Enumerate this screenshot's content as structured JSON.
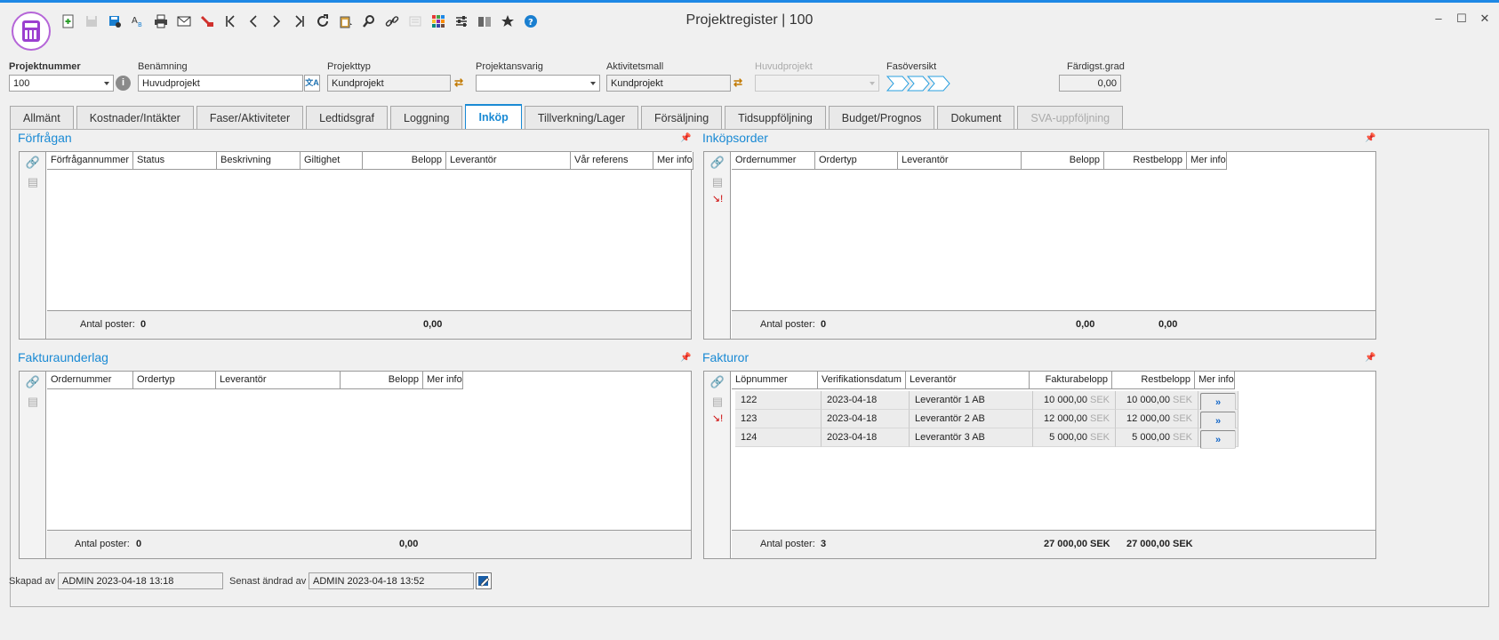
{
  "window": {
    "title": "Projektregister | 100",
    "minimize": "–",
    "maximize": "☐",
    "close": "✕"
  },
  "toolbar": [
    "new-icon",
    "save-icon",
    "save-as-icon",
    "spellcheck-icon",
    "print-icon",
    "mail-icon",
    "pdf-icon",
    "first-icon",
    "prev-icon",
    "next-icon",
    "last-icon",
    "refresh-icon",
    "clipboard-icon",
    "search-icon",
    "link-icon",
    "report-icon",
    "grid-icon",
    "settings-icon",
    "compare-icon",
    "favorite-icon",
    "help-icon"
  ],
  "header": {
    "projektnummer_label": "Projektnummer",
    "projektnummer_value": "100",
    "benamning_label": "Benämning",
    "benamning_value": "Huvudprojekt",
    "projekttyp_label": "Projekttyp",
    "projekttyp_value": "Kundprojekt",
    "projektansvarig_label": "Projektansvarig",
    "projektansvarig_value": "",
    "aktivitetsmall_label": "Aktivitetsmall",
    "aktivitetsmall_value": "Kundprojekt",
    "huvudprojekt_label": "Huvudprojekt",
    "huvudprojekt_value": "",
    "fasoversikt_label": "Fasöversikt",
    "fardigst_label": "Färdigst.grad",
    "fardigst_value": "0,00"
  },
  "tabs": [
    {
      "label": "Allmänt",
      "state": "normal"
    },
    {
      "label": "Kostnader/Intäkter",
      "state": "normal"
    },
    {
      "label": "Faser/Aktiviteter",
      "state": "normal"
    },
    {
      "label": "Ledtidsgraf",
      "state": "normal"
    },
    {
      "label": "Loggning",
      "state": "normal"
    },
    {
      "label": "Inköp",
      "state": "active"
    },
    {
      "label": "Tillverkning/Lager",
      "state": "normal"
    },
    {
      "label": "Försäljning",
      "state": "normal"
    },
    {
      "label": "Tidsuppföljning",
      "state": "normal"
    },
    {
      "label": "Budget/Prognos",
      "state": "normal"
    },
    {
      "label": "Dokument",
      "state": "normal"
    },
    {
      "label": "SVA-uppföljning",
      "state": "disabled"
    }
  ],
  "forfragan": {
    "title": "Förfrågan",
    "columns": [
      "Förfrågannummer",
      "Status",
      "Beskrivning",
      "Giltighet",
      "Belopp",
      "Leverantör",
      "Vår referens",
      "Mer info"
    ],
    "footer_label": "Antal poster:",
    "count": "0",
    "sum": "0,00"
  },
  "inkopsorder": {
    "title": "Inköpsorder",
    "columns": [
      "Ordernummer",
      "Ordertyp",
      "Leverantör",
      "Belopp",
      "Restbelopp",
      "Mer info"
    ],
    "footer_label": "Antal poster:",
    "count": "0",
    "sum1": "0,00",
    "sum2": "0,00"
  },
  "fakturaunderlag": {
    "title": "Fakturaunderlag",
    "columns": [
      "Ordernummer",
      "Ordertyp",
      "Leverantör",
      "Belopp",
      "Mer info"
    ],
    "footer_label": "Antal poster:",
    "count": "0",
    "sum": "0,00"
  },
  "fakturor": {
    "title": "Fakturor",
    "columns": [
      "Löpnummer",
      "Verifikationsdatum",
      "Leverantör",
      "Fakturabelopp",
      "Restbelopp",
      "Mer info"
    ],
    "rows": [
      {
        "lopnummer": "122",
        "datum": "2023-04-18",
        "leverantor": "Leverantör 1 AB",
        "belopp": "10 000,00",
        "valuta": "SEK",
        "rest": "10 000,00",
        "rest_valuta": "SEK"
      },
      {
        "lopnummer": "123",
        "datum": "2023-04-18",
        "leverantor": "Leverantör 2 AB",
        "belopp": "12 000,00",
        "valuta": "SEK",
        "rest": "12 000,00",
        "rest_valuta": "SEK"
      },
      {
        "lopnummer": "124",
        "datum": "2023-04-18",
        "leverantor": "Leverantör 3 AB",
        "belopp": "5 000,00",
        "valuta": "SEK",
        "rest": "5 000,00",
        "rest_valuta": "SEK"
      }
    ],
    "more_button": "»",
    "footer_label": "Antal poster:",
    "count": "3",
    "sum1": "27 000,00 SEK",
    "sum2": "27 000,00 SEK"
  },
  "footer": {
    "skapad_label": "Skapad av",
    "skapad_value": "ADMIN 2023-04-18 13:18",
    "andrad_label": "Senast ändrad av",
    "andrad_value": "ADMIN 2023-04-18 13:52"
  },
  "colors": {
    "accent": "#1a8ad4",
    "logo": "#9b3fd0"
  }
}
